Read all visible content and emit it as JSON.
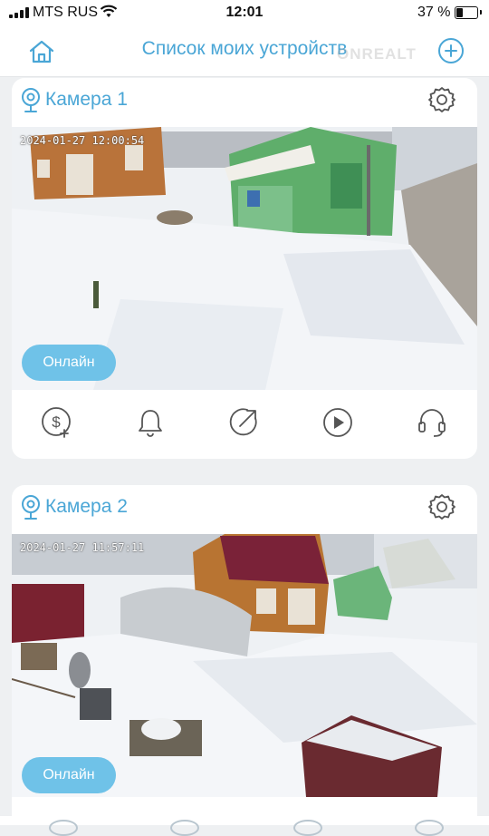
{
  "status_bar": {
    "carrier": "MTS RUS",
    "time": "12:01",
    "battery_percent": "37 %",
    "battery_level": 0.37
  },
  "header": {
    "title": "Список моих устройств",
    "watermark": "ONREALT"
  },
  "cameras": [
    {
      "name": "Камера 1",
      "timestamp": "2024-01-27  12:00:54",
      "status": "Онлайн"
    },
    {
      "name": "Камера 2",
      "timestamp": "2024-01-27  11:57:11",
      "status": "Онлайн"
    }
  ],
  "actions": [
    "cloud-pay-icon",
    "bell-icon",
    "share-icon",
    "playback-icon",
    "headset-icon"
  ],
  "colors": {
    "accent": "#4aa6d6",
    "badge": "#6fc2e8",
    "background": "#eef0f2"
  }
}
